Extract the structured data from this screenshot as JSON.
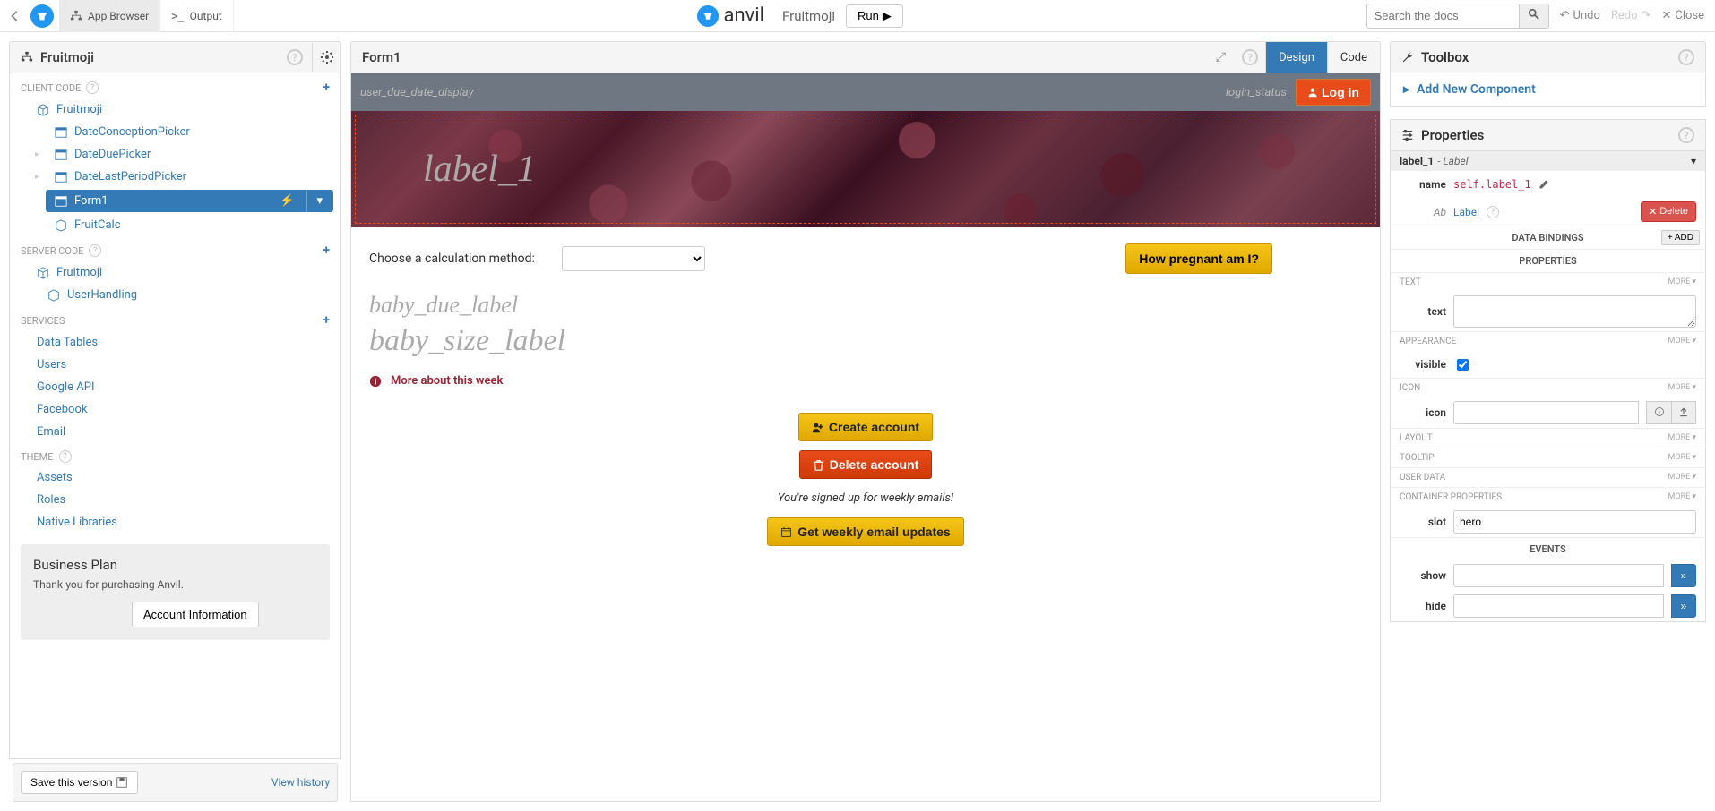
{
  "topbar": {
    "app_browser": "App Browser",
    "output": "Output",
    "brand": "anvil",
    "app_name": "Fruitmoji",
    "run": "Run",
    "search_placeholder": "Search the docs",
    "undo": "Undo",
    "redo": "Redo",
    "close": "Close"
  },
  "left": {
    "title": "Fruitmoji",
    "sections": {
      "client": "CLIENT CODE",
      "server": "SERVER CODE",
      "services": "SERVICES",
      "theme": "THEME"
    },
    "client_items": [
      "Fruitmoji",
      "DateConceptionPicker",
      "DateDuePicker",
      "DateLastPeriodPicker",
      "Form1",
      "FruitCalc"
    ],
    "server_items": [
      "Fruitmoji",
      "UserHandling"
    ],
    "service_items": [
      "Data Tables",
      "Users",
      "Google API",
      "Facebook",
      "Email"
    ],
    "theme_items": [
      "Assets",
      "Roles",
      "Native Libraries"
    ],
    "plan": {
      "title": "Business Plan",
      "desc": "Thank-you for purchasing Anvil.",
      "btn": "Account Information"
    },
    "save": "Save this version",
    "history": "View history"
  },
  "center": {
    "title": "Form1",
    "tabs": {
      "design": "Design",
      "code": "Code"
    },
    "topbar": {
      "due": "user_due_date_display",
      "login_status": "login_status",
      "login": "Log in"
    },
    "hero_label": "label_1",
    "calc_label": "Choose a calculation method:",
    "calc_btn": "How pregnant am I?",
    "baby_due": "baby_due_label",
    "baby_size": "baby_size_label",
    "more": "More about this week",
    "create": "Create account",
    "delete": "Delete account",
    "signed": "You're signed up for weekly emails!",
    "weekly": "Get weekly email updates"
  },
  "right": {
    "toolbox": "Toolbox",
    "add": "Add New Component",
    "properties": "Properties",
    "selected": {
      "name": "label_1",
      "type": "Label"
    },
    "name_label": "name",
    "name_value": "self.label_1",
    "type_link": "Label",
    "delete": "Delete",
    "bindings": "DATA BINDINGS",
    "add_binding": "+ ADD",
    "props_title": "PROPERTIES",
    "groups": {
      "text": "TEXT",
      "appearance": "APPEARANCE",
      "icon": "ICON",
      "layout": "LAYOUT",
      "tooltip": "TOOLTIP",
      "userdata": "USER DATA",
      "container": "CONTAINER PROPERTIES"
    },
    "more": "MORE",
    "fields": {
      "text": "text",
      "visible": "visible",
      "icon": "icon",
      "slot": "slot",
      "show": "show",
      "hide": "hide"
    },
    "slot_value": "hero",
    "events": "EVENTS",
    "go": "»"
  }
}
